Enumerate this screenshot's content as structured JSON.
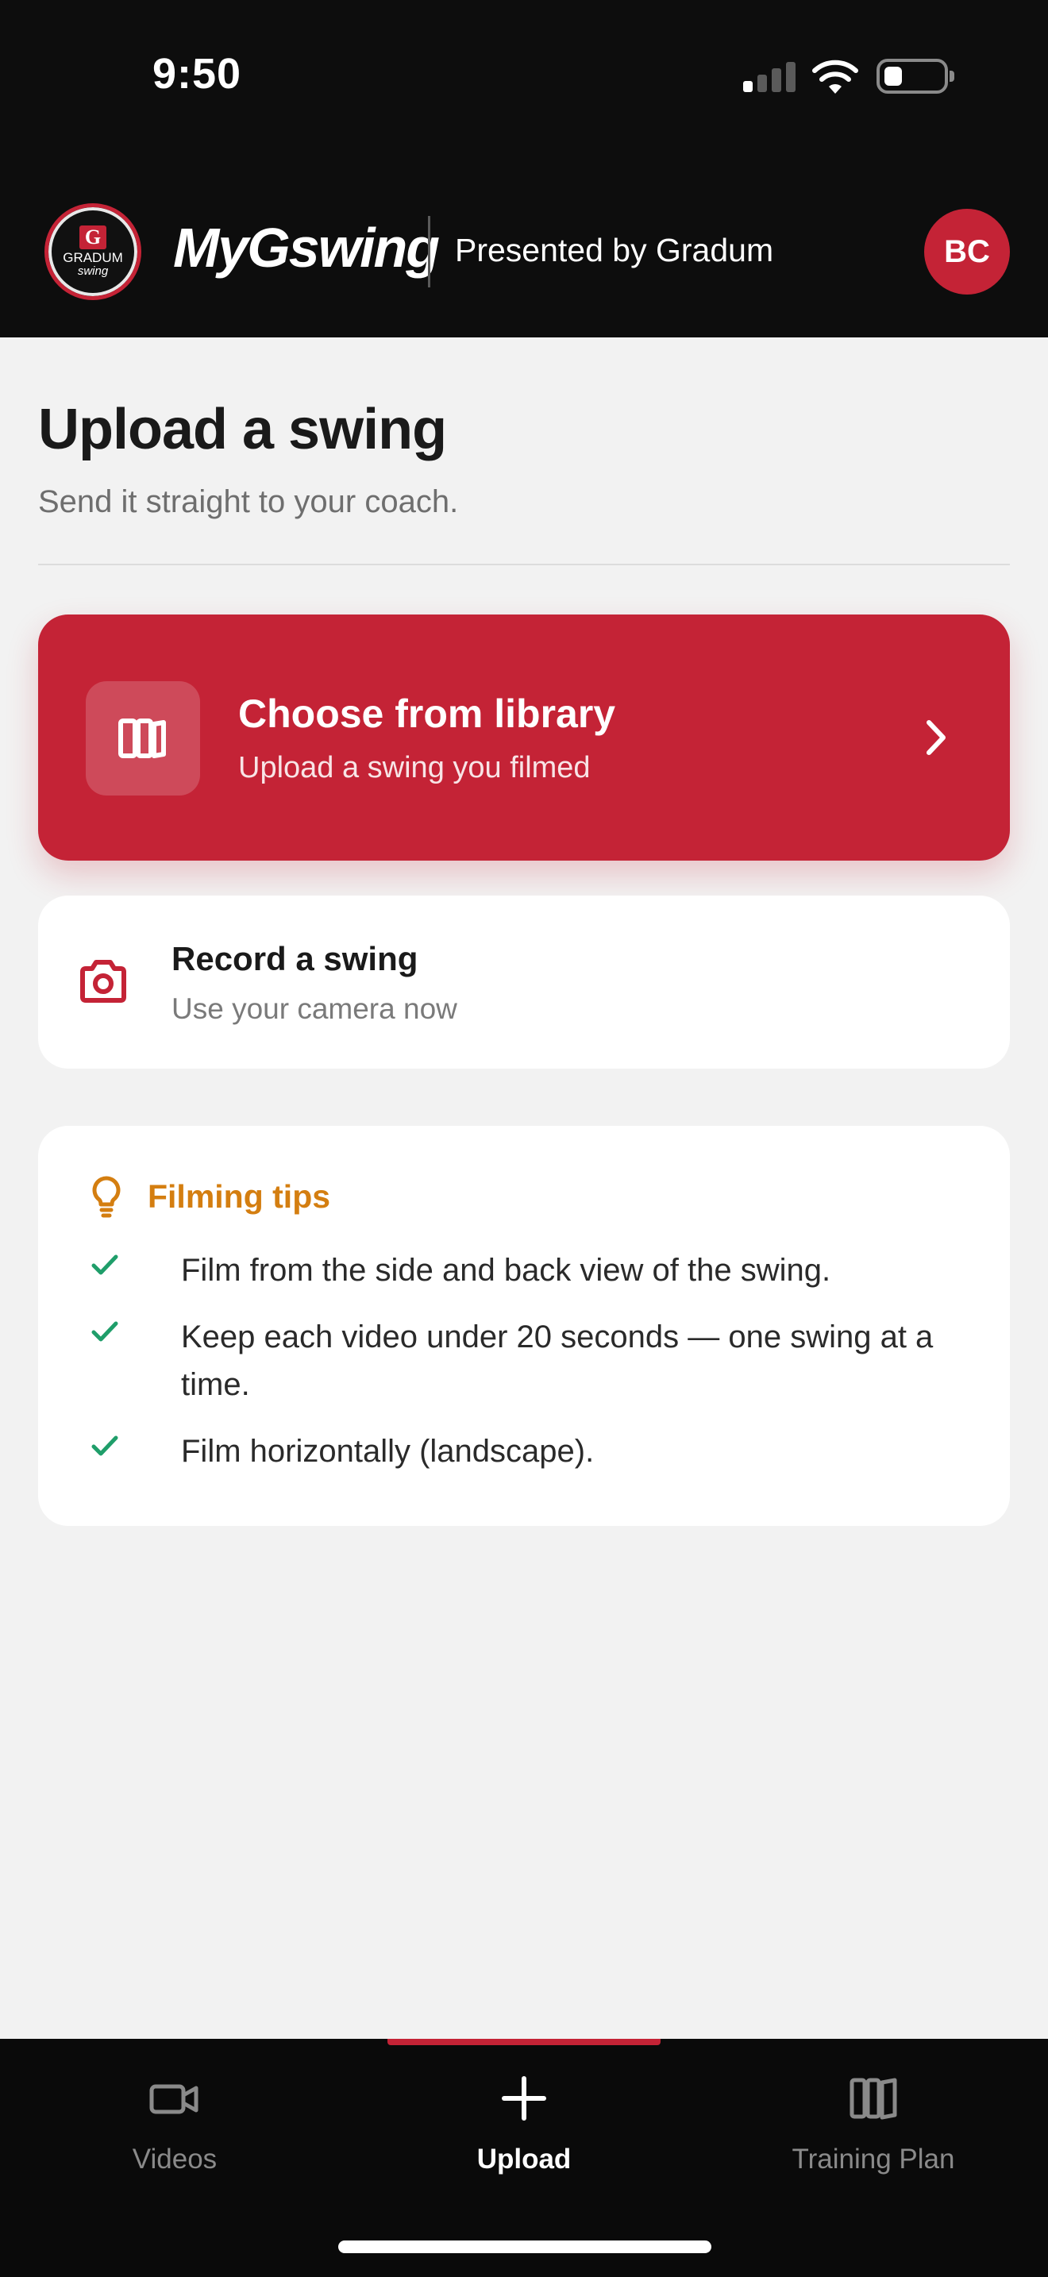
{
  "status_bar": {
    "time": "9:50",
    "icons": [
      "cellular-signal-icon",
      "wifi-icon",
      "battery-icon"
    ]
  },
  "header": {
    "logo_text_top": "GRADUM",
    "logo_text_bottom": "swing",
    "logo_letter": "G",
    "brand": "MyGswing",
    "presented_by": "Presented by Gradum",
    "avatar_initials": "BC"
  },
  "page": {
    "title": "Upload a swing",
    "subtitle": "Send it straight to your coach."
  },
  "library_card": {
    "title": "Choose from library",
    "subtitle": "Upload a swing you filmed",
    "icon": "library-icon"
  },
  "record_card": {
    "title": "Record a swing",
    "subtitle": "Use your camera now",
    "icon": "camera-icon"
  },
  "tips": {
    "heading": "Filming tips",
    "items": [
      "Film from the side and back view of the swing.",
      "Keep each video under 20 seconds — one swing at a time.",
      "Film horizontally (landscape)."
    ]
  },
  "bottom_nav": {
    "items": [
      {
        "label": "Videos",
        "icon": "video-camera-icon",
        "active": false
      },
      {
        "label": "Upload",
        "icon": "plus-icon",
        "active": true
      },
      {
        "label": "Training Plan",
        "icon": "book-icon",
        "active": false
      }
    ]
  },
  "colors": {
    "accent": "#c42336",
    "tips_heading": "#d47e10",
    "check": "#1f9e6a",
    "header_bg": "#0d0d0d",
    "page_bg": "#f2f2f2"
  }
}
